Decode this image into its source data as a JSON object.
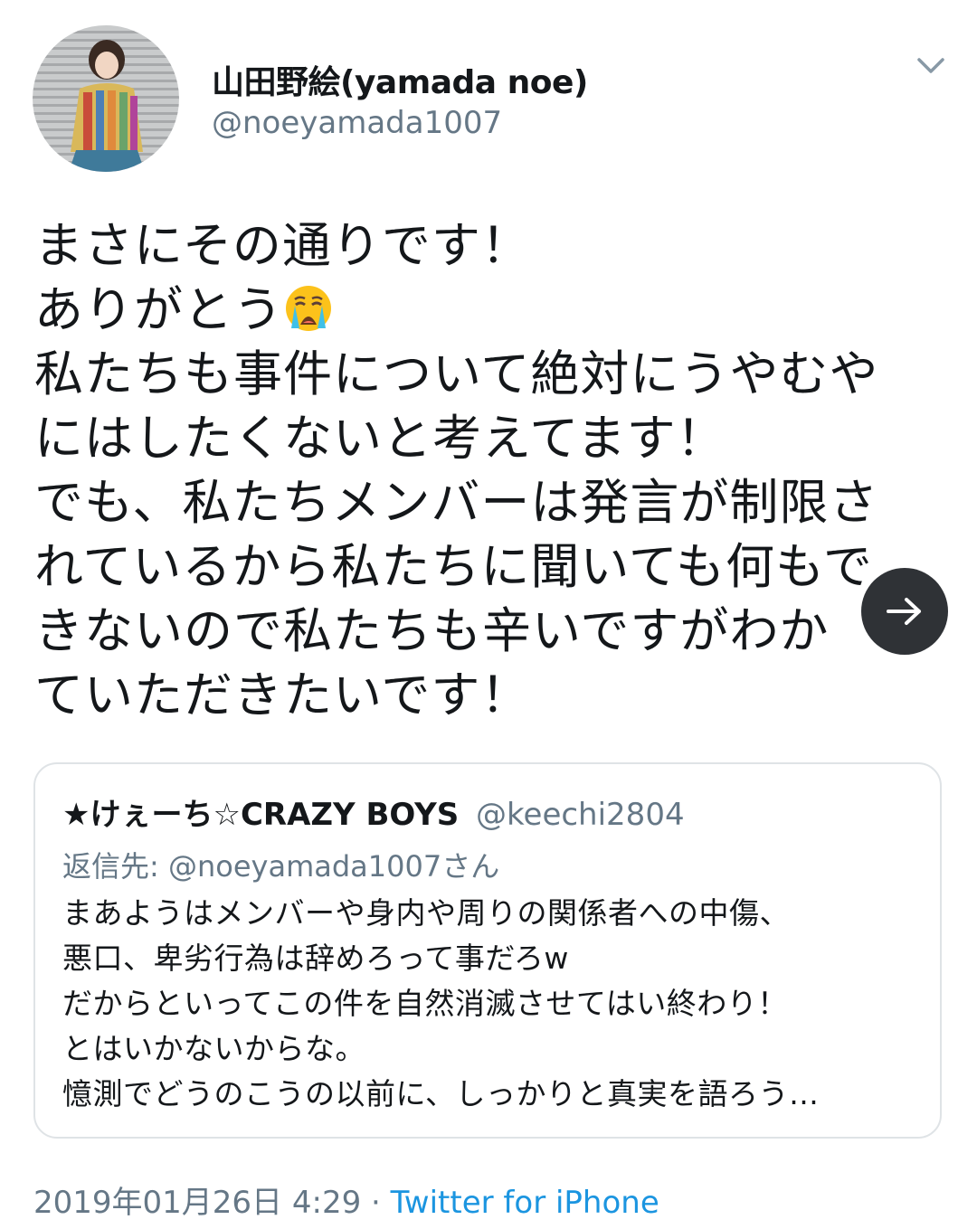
{
  "author": {
    "display_name": "山田野絵(yamada noe)",
    "handle": "@noeyamada1007"
  },
  "tweet": {
    "text": "まさにその通りです！\nありがとう",
    "text_rest": "\n私たちも事件について絶対にうやむや\nにはしたくないと考えてます！\nでも、私たちメンバーは発言が制限さ\nれているから私たちに聞いても何もで\nきないので私たちも辛いですがわか\nていただきたいです！",
    "emoji": "loudly-crying-face-emoji"
  },
  "quoted_tweet": {
    "display_name": "★けぇーち☆CRAZY BOYS",
    "handle": "@keechi2804",
    "reply_label": "返信先: ",
    "reply_user": "@noeyamada1007さん",
    "text": "まあようはメンバーや身内や周りの関係者への中傷、\n悪口、卑劣行為は辞めろって事だろw\nだからといってこの件を自然消滅させてはい終わり！\nとはいかないからな。\n憶測でどうのこうの以前に、しっかりと真実を語ろう…"
  },
  "meta": {
    "timestamp": "2019年01月26日 4:29",
    "separator": " · ",
    "source": "Twitter for iPhone"
  },
  "icons": {
    "menu": "chevron-down-icon",
    "next": "arrow-right-icon"
  },
  "colors": {
    "text": "#14171a",
    "secondary": "#657786",
    "link": "#1b95e0",
    "border": "#dfe3e6"
  }
}
